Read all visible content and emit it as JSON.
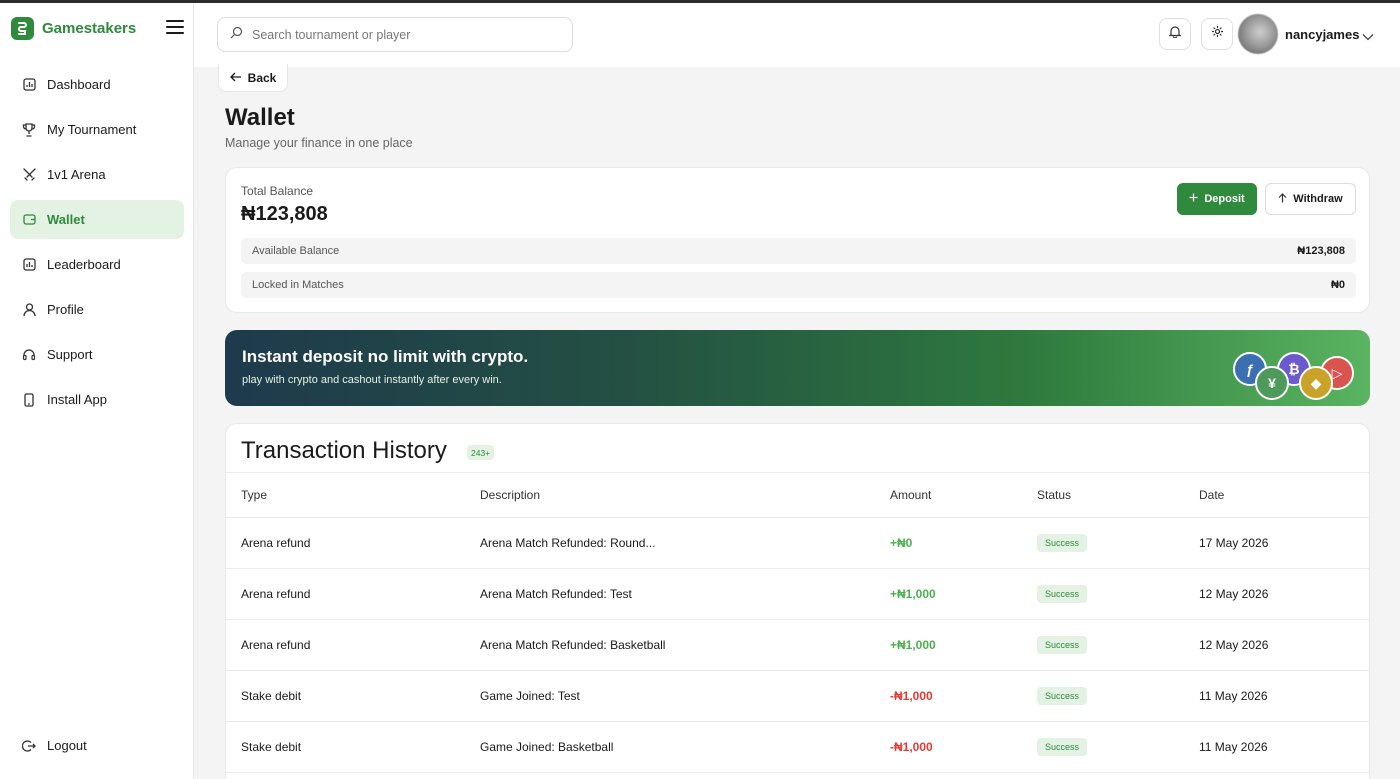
{
  "brand": {
    "name": "Gamestakers"
  },
  "sidebar": {
    "items": [
      {
        "label": "Dashboard",
        "icon": "dashboard-icon"
      },
      {
        "label": "My Tournament",
        "icon": "trophy-icon"
      },
      {
        "label": "1v1 Arena",
        "icon": "swords-icon"
      },
      {
        "label": "Wallet",
        "icon": "wallet-icon",
        "active": true
      },
      {
        "label": "Leaderboard",
        "icon": "leaderboard-icon"
      },
      {
        "label": "Profile",
        "icon": "user-icon"
      },
      {
        "label": "Support",
        "icon": "headset-icon"
      },
      {
        "label": "Install App",
        "icon": "phone-icon"
      }
    ],
    "logout_label": "Logout"
  },
  "header": {
    "search_placeholder": "Search tournament or player",
    "username": "nancyjames"
  },
  "page": {
    "back_label": "Back",
    "title": "Wallet",
    "subtitle": "Manage your finance in one place"
  },
  "balance": {
    "total_label": "Total Balance",
    "total_value": "₦123,808",
    "deposit_label": "Deposit",
    "withdraw_label": "Withdraw",
    "available_label": "Available Balance",
    "available_value": "₦123,808",
    "locked_label": "Locked in Matches",
    "locked_value": "₦0"
  },
  "promo": {
    "title": "Instant deposit no limit with crypto.",
    "subtitle": "play with crypto and cashout instantly after every win."
  },
  "transactions": {
    "title": "Transaction History",
    "count_badge": "243+",
    "columns": {
      "type": "Type",
      "description": "Description",
      "amount": "Amount",
      "status": "Status",
      "date": "Date"
    },
    "rows": [
      {
        "type": "Arena refund",
        "description": "Arena Match Refunded: Round...",
        "amount": "+₦0",
        "status": "Success",
        "date": "17 May 2026"
      },
      {
        "type": "Arena refund",
        "description": "Arena Match Refunded: Test",
        "amount": "+₦1,000",
        "status": "Success",
        "date": "12 May 2026"
      },
      {
        "type": "Arena refund",
        "description": "Arena Match Refunded: Basketball",
        "amount": "+₦1,000",
        "status": "Success",
        "date": "12 May 2026"
      },
      {
        "type": "Stake debit",
        "description": "Game Joined: Test",
        "amount": "-₦1,000",
        "status": "Success",
        "date": "11 May 2026"
      },
      {
        "type": "Stake debit",
        "description": "Game Joined: Basketball",
        "amount": "-₦1,000",
        "status": "Success",
        "date": "11 May 2026"
      }
    ]
  },
  "colors": {
    "brand": "#2f8a3e",
    "positive": "#4caf50",
    "negative": "#e53935",
    "active_bg": "#e3f2e3"
  }
}
